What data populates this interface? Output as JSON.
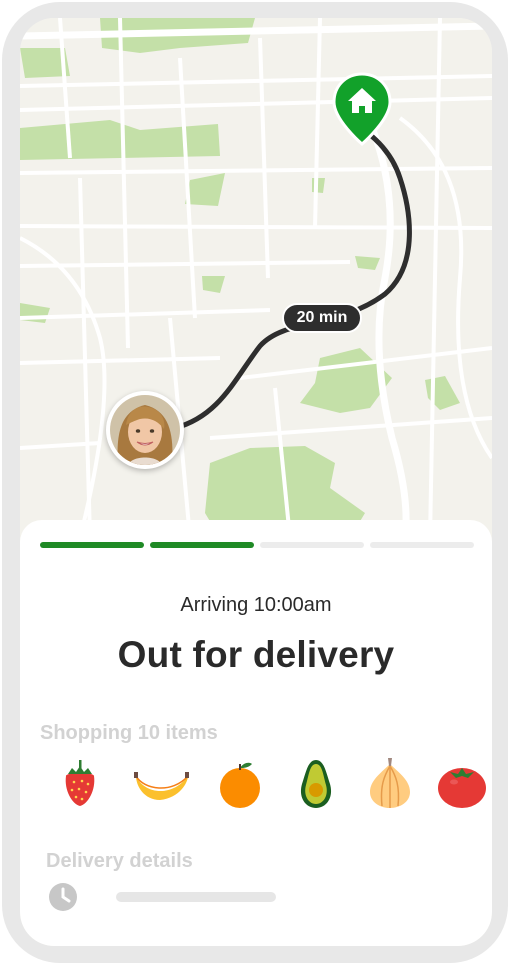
{
  "map": {
    "route_time": "20 min",
    "colors": {
      "land": "#f3f2ec",
      "park": "#c4e0a8",
      "road": "#ffffff",
      "route": "#2e2e2e",
      "pin": "#12a12a"
    }
  },
  "delivery": {
    "arriving": "Arriving 10:00am",
    "status": "Out for delivery",
    "progress": {
      "total_steps": 4,
      "completed_steps": 2
    }
  },
  "shopping": {
    "label": "Shopping 10 items",
    "items": [
      {
        "icon": "strawberry-icon"
      },
      {
        "icon": "banana-icon"
      },
      {
        "icon": "orange-icon"
      },
      {
        "icon": "avocado-icon"
      },
      {
        "icon": "onion-icon"
      },
      {
        "icon": "tomato-icon"
      }
    ]
  },
  "details": {
    "label": "Delivery details",
    "icon": "clock-icon"
  }
}
